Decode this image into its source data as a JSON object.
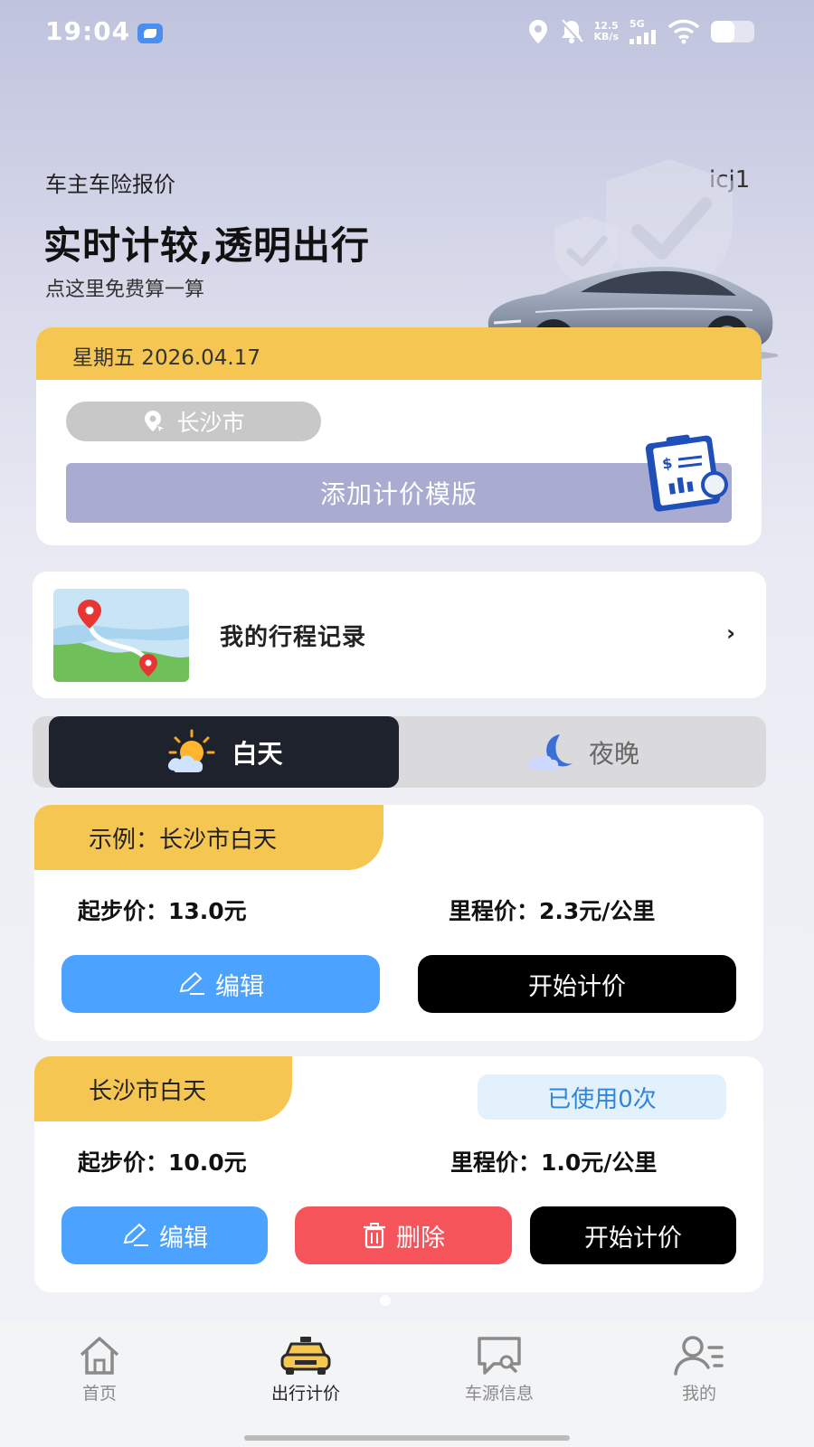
{
  "status_bar": {
    "time": "19:04",
    "net_speed_value": "12.5",
    "net_speed_unit": "KB/s",
    "network": "5G",
    "battery_level": 0.55
  },
  "hero": {
    "subtitle": "车主车险报价",
    "user": "icj1",
    "title": "实时计较,透明出行",
    "desc": "点这里免费算一算"
  },
  "date_card": {
    "date": "星期五 2026.04.17",
    "city": "长沙市",
    "add_template_label": "添加计价模版"
  },
  "trip": {
    "label": "我的行程记录",
    "chevron": "›"
  },
  "tabs": {
    "day": "白天",
    "night": "夜晚",
    "active": "day"
  },
  "cards": [
    {
      "tag": "示例：长沙市白天",
      "start_price": "起步价：13.0元",
      "mileage_price": "里程价：2.3元/公里",
      "edit_label": "编辑",
      "start_label": "开始计价"
    },
    {
      "tag": "长沙市白天",
      "usage": "已使用0次",
      "start_price": "起步价：10.0元",
      "mileage_price": "里程价：1.0元/公里",
      "edit_label": "编辑",
      "delete_label": "删除",
      "start_label": "开始计价"
    }
  ],
  "nav": [
    {
      "label": "首页",
      "icon": "home-icon"
    },
    {
      "label": "出行计价",
      "icon": "taxi-icon"
    },
    {
      "label": "车源信息",
      "icon": "car-info-icon"
    },
    {
      "label": "我的",
      "icon": "profile-icon"
    }
  ],
  "colors": {
    "accent_yellow": "#f5c652",
    "edit_blue": "#4ba3ff",
    "delete_red": "#f5555a",
    "template_button": "#a9abd0"
  }
}
